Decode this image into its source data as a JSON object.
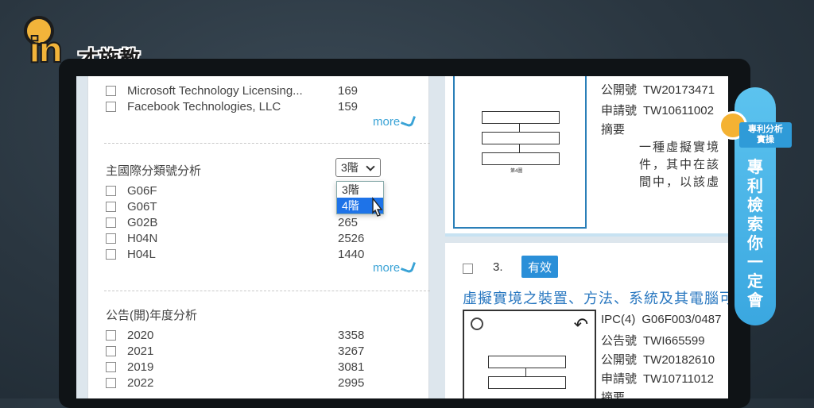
{
  "logo": {
    "letter": "in",
    "brand": "才施教"
  },
  "left_panel": {
    "assignee_rows": [
      {
        "name": "Microsoft Technology Licensing...",
        "count": "169"
      },
      {
        "name": "Facebook Technologies, LLC",
        "count": "159"
      }
    ],
    "more_label": "more",
    "ipc_section": {
      "title": "主國際分類號分析",
      "select_value": "3階",
      "dropdown_options": [
        "3階",
        "4階"
      ],
      "selected_option": "4階",
      "rows": [
        {
          "name": "G06F",
          "count": ""
        },
        {
          "name": "G06T",
          "count": ""
        },
        {
          "name": "G02B",
          "count": "265"
        },
        {
          "name": "H04N",
          "count": "2526"
        },
        {
          "name": "H04L",
          "count": "1440"
        }
      ]
    },
    "year_section": {
      "title": "公告(開)年度分析",
      "rows": [
        {
          "name": "2020",
          "count": "3358"
        },
        {
          "name": "2021",
          "count": "3267"
        },
        {
          "name": "2019",
          "count": "3081"
        },
        {
          "name": "2022",
          "count": "2995"
        }
      ]
    }
  },
  "results": {
    "card1": {
      "pub_label": "公開號",
      "pub_value": "TW20173471",
      "app_label": "申請號",
      "app_value": "TW10611002",
      "abstract_label": "摘要",
      "abstract_lines": [
        "一種虛擬實境",
        "件，其中在該",
        "間中，以該虛"
      ],
      "fig_label": "第4圖"
    },
    "card2": {
      "number": "3.",
      "badge": "有效",
      "title": "虛擬實境之裝置、方法、系統及其電腦可",
      "ipc_label": "IPC(4)",
      "ipc_value": "G06F003/0487",
      "notice_label": "公告號",
      "notice_value": "TWI665599",
      "pub_label": "公開號",
      "pub_value": "TW20182610",
      "app_label": "申請號",
      "app_value": "TW10711012",
      "abstract_label": "摘要"
    }
  },
  "ribbon": {
    "tag": "專利分析\n實操",
    "vertical": "專利檢索你一定會"
  },
  "colors": {
    "accent": "#3aa3d6",
    "badge": "#2a8fd8",
    "title_link": "#2877c0",
    "ribbon": "#5cc3ef"
  }
}
